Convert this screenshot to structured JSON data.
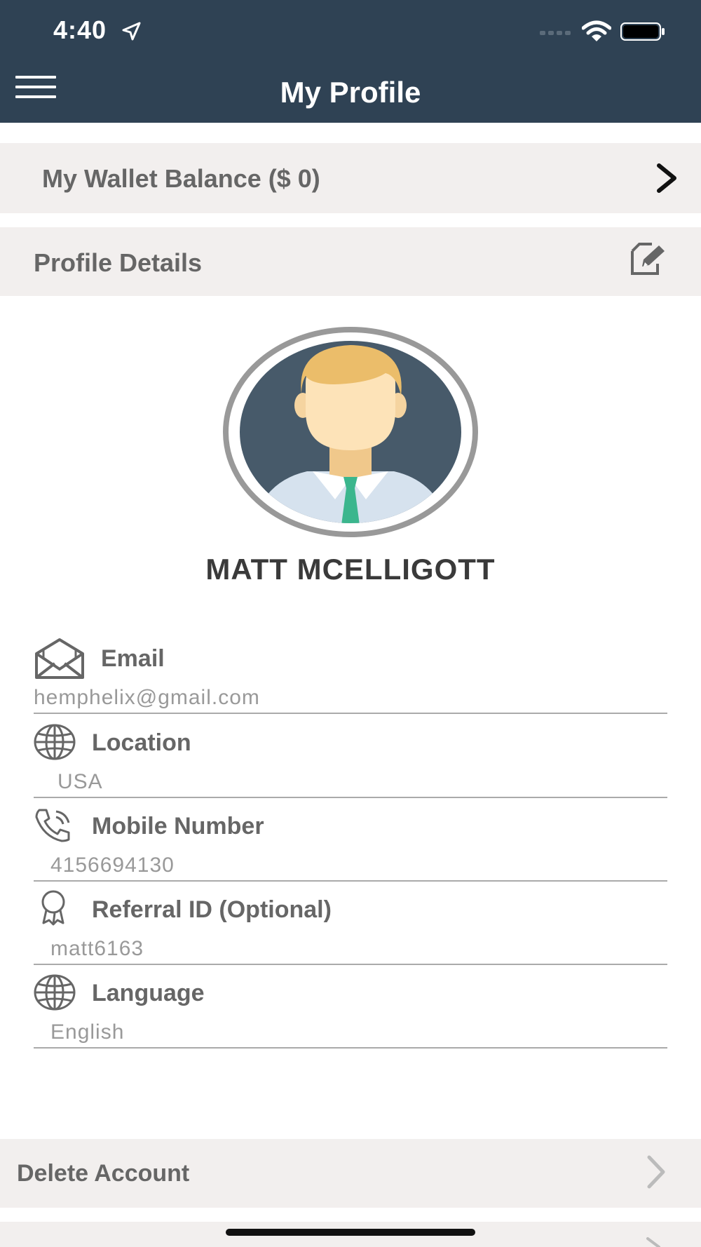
{
  "status_bar": {
    "time": "4:40"
  },
  "header": {
    "title": "My Profile"
  },
  "wallet": {
    "label": "My Wallet Balance ($ 0)"
  },
  "profile_section": {
    "label": "Profile Details"
  },
  "user": {
    "name": "MATT MCELLIGOTT"
  },
  "fields": [
    {
      "label": "Email",
      "value": "hemphelix@gmail.com",
      "icon": "envelope-icon"
    },
    {
      "label": "Location",
      "value": "USA",
      "icon": "globe-icon"
    },
    {
      "label": "Mobile Number",
      "value": "4156694130",
      "icon": "phone-icon"
    },
    {
      "label": "Referral ID (Optional)",
      "value": "matt6163",
      "icon": "award-icon"
    },
    {
      "label": "Language",
      "value": "English",
      "icon": "globe-icon"
    }
  ],
  "actions": {
    "delete_label": "Delete Account"
  },
  "colors": {
    "header_bg": "#2f4254",
    "bar_bg": "#f2efee",
    "label_text": "#666666",
    "value_text": "#999999"
  }
}
